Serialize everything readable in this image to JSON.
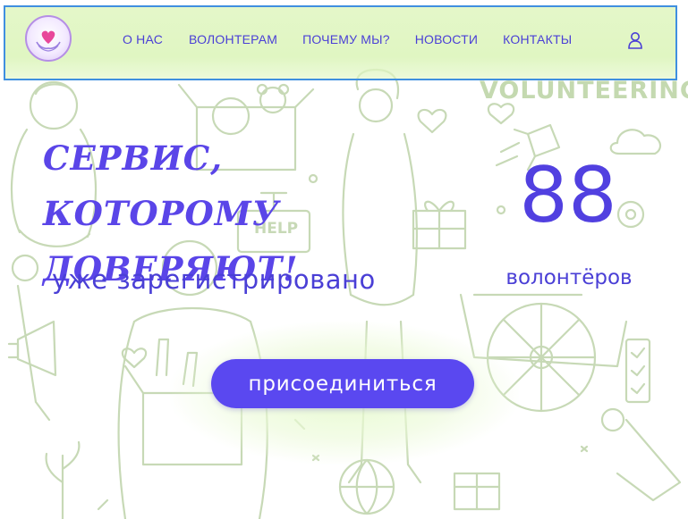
{
  "header": {
    "nav": [
      "О НАС",
      "ВОЛОНТЕРАМ",
      "ПОЧЕМУ МЫ?",
      "НОВОСТИ",
      "КОНТАКТЫ"
    ],
    "user_icon": "user-icon",
    "logo_icon": "heart-hands-icon"
  },
  "background": {
    "volunteering_word": "VOLUNTEERING",
    "help_sign": "HELP"
  },
  "hero": {
    "title_line1": "СЕРВИС, КОТОРОМУ",
    "title_line2": "ДОВЕРЯЮТ!",
    "subtitle": "уже зарегистрировано",
    "counter_value": "88",
    "counter_label": "волонтёров",
    "join_button": "присоединиться"
  },
  "colors": {
    "accent": "#5a48f0",
    "header_bg": "#e0f6c2",
    "header_border": "#3f8fe0",
    "text": "#4a3fd6",
    "line_art": "#c7d9b6"
  }
}
